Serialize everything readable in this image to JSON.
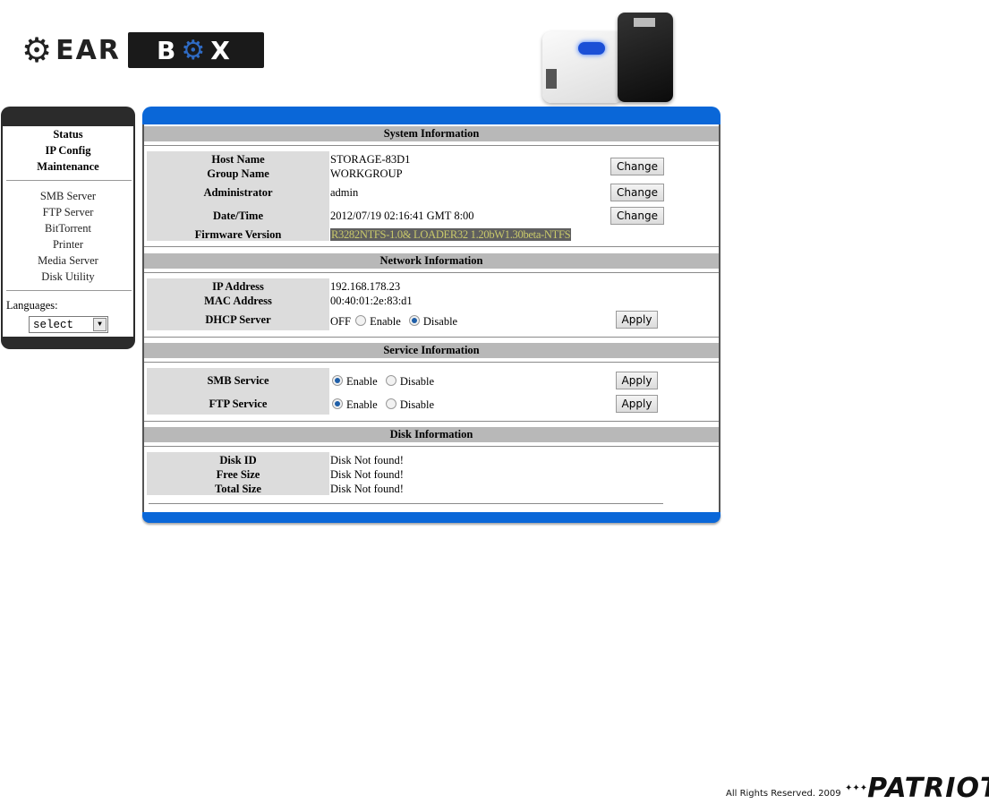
{
  "header": {
    "logo_left": "EAR",
    "logo_gear_glyph": "⚙",
    "logo_right_b": "B",
    "logo_right_x": "X"
  },
  "sidebar": {
    "primary_items": [
      {
        "label": "Status"
      },
      {
        "label": "IP Config"
      },
      {
        "label": "Maintenance"
      }
    ],
    "secondary_items": [
      {
        "label": "SMB Server"
      },
      {
        "label": "FTP Server"
      },
      {
        "label": "BitTorrent"
      },
      {
        "label": "Printer"
      },
      {
        "label": "Media Server"
      },
      {
        "label": "Disk Utility"
      }
    ],
    "languages_label": "Languages:",
    "language_select_value": "select",
    "dropdown_arrow": "▼"
  },
  "system": {
    "title": "System Information",
    "host_name_label": "Host Name",
    "host_name": "STORAGE-83D1",
    "group_name_label": "Group Name",
    "group_name": "WORKGROUP",
    "administrator_label": "Administrator",
    "administrator": "admin",
    "datetime_label": "Date/Time",
    "datetime": "2012/07/19 02:16:41 GMT 8:00",
    "firmware_label": "Firmware Version",
    "firmware": "R3282NTFS-1.0& LOADER32 1.20bW1.30beta-NTFS",
    "change_label": "Change"
  },
  "network": {
    "title": "Network Information",
    "ip_label": "IP Address",
    "ip": "192.168.178.23",
    "mac_label": "MAC Address",
    "mac": "00:40:01:2e:83:d1",
    "dhcp_label": "DHCP Server",
    "dhcp_status": "OFF",
    "enable_label": "Enable",
    "disable_label": "Disable",
    "dhcp_selected": "Disable",
    "apply_label": "Apply"
  },
  "service": {
    "title": "Service Information",
    "smb_label": "SMB Service",
    "smb_selected": "Enable",
    "ftp_label": "FTP Service",
    "ftp_selected": "Enable",
    "enable_label": "Enable",
    "disable_label": "Disable",
    "apply_label": "Apply"
  },
  "disk": {
    "title": "Disk Information",
    "disk_id_label": "Disk ID",
    "disk_id": "Disk Not found!",
    "free_size_label": "Free Size",
    "free_size": "Disk Not found!",
    "total_size_label": "Total Size",
    "total_size": "Disk Not found!"
  },
  "footer": {
    "copyright": "All Rights Reserved. 2009",
    "brand": "PATRIOT",
    "brand_stars": "✦✦✦"
  }
}
